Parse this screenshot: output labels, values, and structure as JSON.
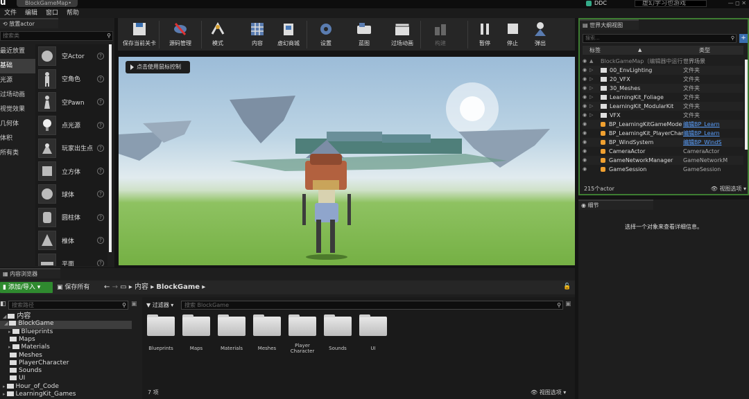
{
  "titlebar": {
    "logo": "u",
    "doc_tab": "BlockGameMap•",
    "ddc_label": "DDC",
    "search_text": "虚幻学习也游戏",
    "window_controls": "— ◻ ✕"
  },
  "menu": [
    "文件",
    "编辑",
    "窗口",
    "帮助"
  ],
  "place_actors": {
    "tab_label": "放置actor",
    "search_placeholder": "搜索类",
    "categories": [
      {
        "label": "最近放置",
        "selected": false
      },
      {
        "label": "基础",
        "selected": true
      },
      {
        "label": "光源",
        "selected": false
      },
      {
        "label": "过场动画",
        "selected": false
      },
      {
        "label": "视觉效果",
        "selected": false
      },
      {
        "label": "几何体",
        "selected": false
      },
      {
        "label": "体积",
        "selected": false
      },
      {
        "label": "所有类",
        "selected": false
      }
    ],
    "items": [
      {
        "label": "空Actor",
        "icon": "sphere-icon"
      },
      {
        "label": "空角色",
        "icon": "character-icon"
      },
      {
        "label": "空Pawn",
        "icon": "pawn-icon"
      },
      {
        "label": "点光源",
        "icon": "point-light-icon"
      },
      {
        "label": "玩家出生点",
        "icon": "player-start-icon"
      },
      {
        "label": "立方体",
        "icon": "cube-icon"
      },
      {
        "label": "球体",
        "icon": "sphere-icon"
      },
      {
        "label": "圆柱体",
        "icon": "cylinder-icon"
      },
      {
        "label": "椎体",
        "icon": "cone-icon"
      },
      {
        "label": "平面",
        "icon": "plane-icon"
      }
    ],
    "help_glyph": "?"
  },
  "toolbar": {
    "buttons": [
      {
        "label": "保存当前关卡",
        "icon": "save-icon",
        "enabled": true
      },
      {
        "label": "源码管理",
        "icon": "source-control-icon",
        "enabled": true
      },
      {
        "label": "模式",
        "icon": "modes-icon",
        "enabled": true
      },
      {
        "label": "内容",
        "icon": "content-icon",
        "enabled": true
      },
      {
        "label": "虚幻商城",
        "icon": "marketplace-icon",
        "enabled": true
      },
      {
        "label": "设置",
        "icon": "settings-icon",
        "enabled": true
      },
      {
        "label": "蓝图",
        "icon": "blueprint-icon",
        "enabled": true
      },
      {
        "label": "过场动画",
        "icon": "cinematics-icon",
        "enabled": true
      },
      {
        "label": "构建",
        "icon": "build-icon",
        "enabled": false
      },
      {
        "label": "暂停",
        "icon": "pause-icon",
        "enabled": true
      },
      {
        "label": "停止",
        "icon": "stop-icon",
        "enabled": true
      },
      {
        "label": "弹出",
        "icon": "eject-icon",
        "enabled": true
      }
    ]
  },
  "viewport": {
    "hint": "点击使用鼠标控制"
  },
  "outliner": {
    "tab_label": "世界大纲视图",
    "search_placeholder": "搜索...",
    "col_label": "标签",
    "col_type": "类型",
    "rows": [
      {
        "name": "BlockGameMap（编辑器中运行）",
        "type": "世界场景",
        "kind": "world",
        "link": false
      },
      {
        "name": "00_EnvLighting",
        "type": "文件夹",
        "kind": "folder",
        "link": false
      },
      {
        "name": "20_VFX",
        "type": "文件夹",
        "kind": "folder",
        "link": false
      },
      {
        "name": "30_Meshes",
        "type": "文件夹",
        "kind": "folder",
        "link": false
      },
      {
        "name": "LearningKit_Foliage",
        "type": "文件夹",
        "kind": "folder",
        "link": false
      },
      {
        "name": "LearningKit_ModularKit",
        "type": "文件夹",
        "kind": "folder",
        "link": false
      },
      {
        "name": "VFX",
        "type": "文件夹",
        "kind": "folder",
        "link": false
      },
      {
        "name": "BP_LearningKitGameMode",
        "type": "编辑BP_Learn",
        "kind": "actor",
        "link": true
      },
      {
        "name": "BP_LearningKit_PlayerCharacter",
        "type": "编辑BP_Learn",
        "kind": "actor",
        "link": true
      },
      {
        "name": "BP_WindSystem",
        "type": "编辑BP_WindS",
        "kind": "actor",
        "link": true
      },
      {
        "name": "CameraActor",
        "type": "CameraActor",
        "kind": "actor",
        "link": false
      },
      {
        "name": "GameNetworkManager",
        "type": "GameNetworkM",
        "kind": "actor",
        "link": false
      },
      {
        "name": "GameSession",
        "type": "GameSession",
        "kind": "actor",
        "link": false
      }
    ],
    "actor_count": "215个actor",
    "view_options": "视图选项"
  },
  "details": {
    "tab_label": "细节",
    "empty_message": "选择一个对象来查看详细信息。"
  },
  "content_browser": {
    "tab_label": "内容浏览器",
    "add_import": "添加/导入",
    "save_all": "保存所有",
    "breadcrumb": [
      "内容",
      "BlockGame"
    ],
    "path_search_placeholder": "搜索路径",
    "filter_label": "过滤器",
    "asset_search_placeholder": "搜索 BlockGame",
    "tree": [
      {
        "label": "内容",
        "depth": 0,
        "selected": false
      },
      {
        "label": "BlockGame",
        "depth": 1,
        "selected": true
      },
      {
        "label": "Blueprints",
        "depth": 2,
        "selected": false
      },
      {
        "label": "Maps",
        "depth": 2,
        "selected": false
      },
      {
        "label": "Materials",
        "depth": 2,
        "selected": false
      },
      {
        "label": "Meshes",
        "depth": 2,
        "selected": false
      },
      {
        "label": "PlayerCharacter",
        "depth": 2,
        "selected": false
      },
      {
        "label": "Sounds",
        "depth": 2,
        "selected": false
      },
      {
        "label": "UI",
        "depth": 2,
        "selected": false
      },
      {
        "label": "Hour_of_Code",
        "depth": 1,
        "selected": false
      },
      {
        "label": "LearningKit_Games",
        "depth": 1,
        "selected": false
      }
    ],
    "assets": [
      "Blueprints",
      "Maps",
      "Materials",
      "Meshes",
      "Player Character",
      "Sounds",
      "UI"
    ],
    "item_count": "7 项",
    "view_options": "视图选项"
  },
  "colors": {
    "accent_green": "#2f8a2f",
    "outliner_border": "#3e7d32",
    "link_blue": "#5aa0ff"
  }
}
